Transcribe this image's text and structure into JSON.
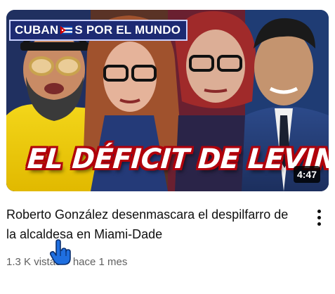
{
  "video": {
    "thumbnail": {
      "channel_banner_left": "CUBAN",
      "channel_banner_right": "S POR EL MUNDO",
      "headline": "EL DÉFICIT DE LEVINE",
      "duration": "4:47"
    },
    "title": "Roberto González desenmascara el despilfarro de la alcaldesa en Miami-Dade",
    "views": "1.3 K vistas",
    "separator": "•",
    "age": "hace 1 mes"
  },
  "icons": {
    "menu": "more-vert-icon",
    "flag": "cuban-flag-icon",
    "cursor": "hand-pointer-cursor"
  },
  "colors": {
    "title_text": "#0f0f0f",
    "meta_text": "#606060",
    "headline_outline": "#b0000b",
    "banner_bg": "#1d2a72",
    "duration_bg": "#000000"
  }
}
